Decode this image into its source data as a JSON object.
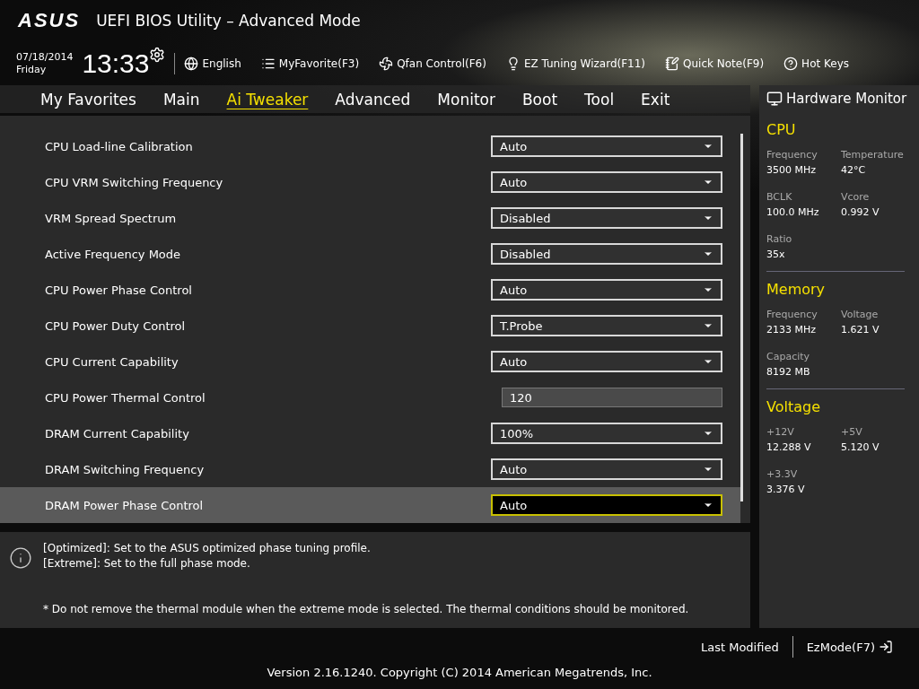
{
  "header": {
    "logo": "ASUS",
    "title": "UEFI BIOS Utility – Advanced Mode",
    "date": "07/18/2014",
    "day": "Friday",
    "time": "13:33",
    "tools": [
      {
        "kind": "globe",
        "label": "English"
      },
      {
        "kind": "list",
        "label": "MyFavorite(F3)"
      },
      {
        "kind": "fan",
        "label": "Qfan Control(F6)"
      },
      {
        "kind": "bulb",
        "label": "EZ Tuning Wizard(F11)"
      },
      {
        "kind": "note",
        "label": "Quick Note(F9)"
      },
      {
        "kind": "help",
        "label": "Hot Keys"
      }
    ]
  },
  "tabs": [
    {
      "label": "My Favorites",
      "selected": false
    },
    {
      "label": "Main",
      "selected": false
    },
    {
      "label": "Ai Tweaker",
      "selected": true
    },
    {
      "label": "Advanced",
      "selected": false
    },
    {
      "label": "Monitor",
      "selected": false
    },
    {
      "label": "Boot",
      "selected": false
    },
    {
      "label": "Tool",
      "selected": false
    },
    {
      "label": "Exit",
      "selected": false
    }
  ],
  "settings": [
    {
      "kind": "dropdown",
      "label": "CPU Load-line Calibration",
      "value": "Auto",
      "selected": false
    },
    {
      "kind": "dropdown",
      "label": "CPU VRM Switching Frequency",
      "value": "Auto",
      "selected": false
    },
    {
      "kind": "dropdown",
      "label": "VRM Spread Spectrum",
      "value": "Disabled",
      "selected": false
    },
    {
      "kind": "dropdown",
      "label": "Active Frequency Mode",
      "value": "Disabled",
      "selected": false
    },
    {
      "kind": "dropdown",
      "label": "CPU Power Phase Control",
      "value": "Auto",
      "selected": false
    },
    {
      "kind": "dropdown",
      "label": "CPU Power Duty Control",
      "value": "T.Probe",
      "selected": false
    },
    {
      "kind": "dropdown",
      "label": "CPU Current Capability",
      "value": "Auto",
      "selected": false
    },
    {
      "kind": "field",
      "label": "CPU Power Thermal Control",
      "value": "120",
      "selected": false
    },
    {
      "kind": "dropdown",
      "label": "DRAM Current Capability",
      "value": "100%",
      "selected": false
    },
    {
      "kind": "dropdown",
      "label": "DRAM Switching Frequency",
      "value": "Auto",
      "selected": false
    },
    {
      "kind": "dropdown",
      "label": "DRAM Power Phase Control",
      "value": "Auto",
      "selected": true
    }
  ],
  "help": {
    "lines": [
      "[Optimized]: Set to the ASUS optimized phase tuning profile.",
      "[Extreme]: Set to the full phase mode."
    ],
    "note": "* Do not remove the thermal module when the extreme mode is selected. The thermal conditions should be monitored."
  },
  "hardware_monitor": {
    "title": "Hardware Monitor",
    "sections": [
      {
        "title": "CPU",
        "items": [
          {
            "label": "Frequency",
            "value": "3500 MHz"
          },
          {
            "label": "Temperature",
            "value": "42°C"
          },
          {
            "label": "BCLK",
            "value": "100.0 MHz"
          },
          {
            "label": "Vcore",
            "value": "0.992 V"
          },
          {
            "label": "Ratio",
            "value": "35x"
          }
        ]
      },
      {
        "title": "Memory",
        "items": [
          {
            "label": "Frequency",
            "value": "2133 MHz"
          },
          {
            "label": "Voltage",
            "value": "1.621 V"
          },
          {
            "label": "Capacity",
            "value": "8192 MB"
          }
        ]
      },
      {
        "title": "Voltage",
        "items": [
          {
            "label": "+12V",
            "value": "12.288 V"
          },
          {
            "label": "+5V",
            "value": "5.120 V"
          },
          {
            "label": "+3.3V",
            "value": "3.376 V"
          }
        ]
      }
    ]
  },
  "footer": {
    "last_modified": "Last Modified",
    "ezmode": "EzMode(F7)",
    "version": "Version 2.16.1240. Copyright (C) 2014 American Megatrends, Inc."
  }
}
